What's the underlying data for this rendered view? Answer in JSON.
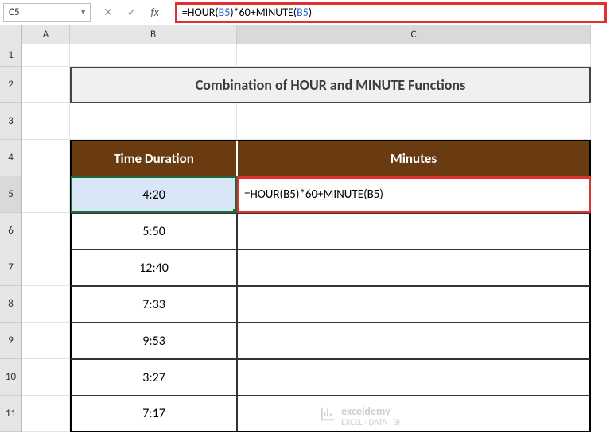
{
  "name_box": {
    "value": "C5"
  },
  "formula_bar": {
    "prefix": "=HOUR(",
    "ref1": "B5",
    "mid": ")*60+MINUTE(",
    "ref2": "B5",
    "suffix": ")"
  },
  "columns": {
    "A": "A",
    "B": "B",
    "C": "C"
  },
  "rows": [
    "1",
    "2",
    "3",
    "4",
    "5",
    "6",
    "7",
    "8",
    "9",
    "10",
    "11"
  ],
  "title": "Combination of HOUR and MINUTE Functions",
  "headers": {
    "time": "Time Duration",
    "minutes": "Minutes"
  },
  "data": [
    {
      "time": "4:20",
      "minutes": "=HOUR(B5)*60+MINUTE(B5)"
    },
    {
      "time": "5:50",
      "minutes": ""
    },
    {
      "time": "12:40",
      "minutes": ""
    },
    {
      "time": "7:33",
      "minutes": ""
    },
    {
      "time": "9:53",
      "minutes": ""
    },
    {
      "time": "3:27",
      "minutes": ""
    },
    {
      "time": "7:17",
      "minutes": ""
    }
  ],
  "chart_data": {
    "type": "table",
    "title": "Combination of HOUR and MINUTE Functions",
    "columns": [
      "Time Duration",
      "Minutes"
    ],
    "rows": [
      [
        "4:20",
        "=HOUR(B5)*60+MINUTE(B5)"
      ],
      [
        "5:50",
        ""
      ],
      [
        "12:40",
        ""
      ],
      [
        "7:33",
        ""
      ],
      [
        "9:53",
        ""
      ],
      [
        "3:27",
        ""
      ],
      [
        "7:17",
        ""
      ]
    ]
  },
  "watermark": {
    "brand": "exceldemy",
    "tagline": "EXCEL · DATA · BI"
  }
}
